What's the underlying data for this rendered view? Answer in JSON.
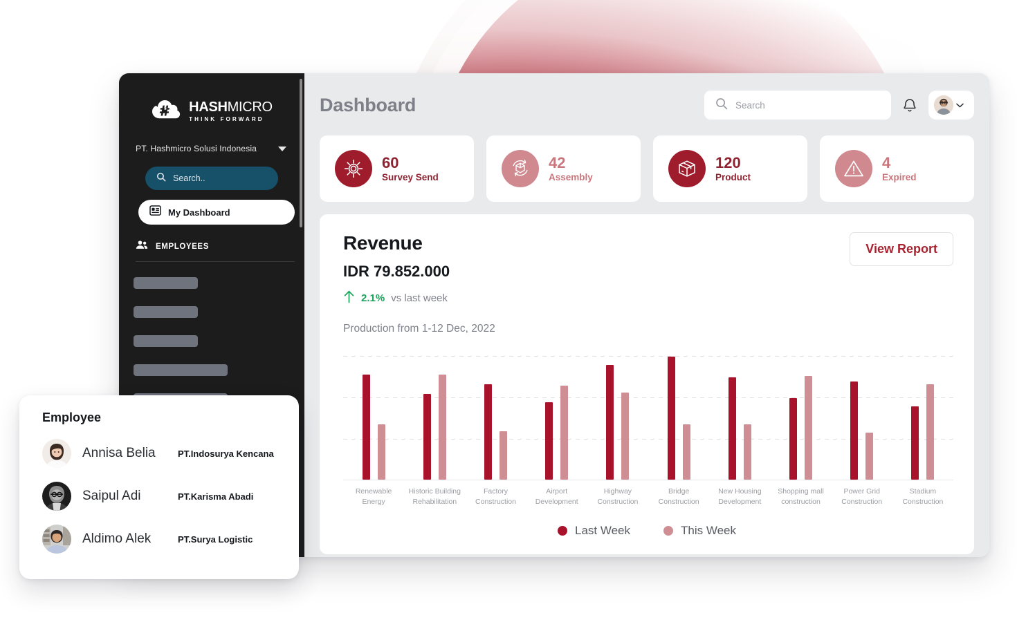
{
  "brand": {
    "name_bold": "HASH",
    "name_light": "MICRO",
    "tagline": "THINK FORWARD",
    "logo_icon": "hash-cloud-logo-icon"
  },
  "sidebar": {
    "company": "PT. Hashmicro Solusi Indonesia",
    "company_caret_icon": "chevron-down-icon",
    "search_placeholder": "Search..",
    "search_icon": "search-icon",
    "active_item": {
      "label": "My Dashboard",
      "icon": "dashboard-icon"
    },
    "section": {
      "label": "EMPLOYEES",
      "icon": "people-icon"
    },
    "skeleton_widths": [
      93,
      93,
      93,
      136,
      136
    ]
  },
  "header": {
    "title": "Dashboard",
    "search_placeholder": "Search",
    "search_value": "",
    "search_icon": "search-icon",
    "bell_icon": "bell-icon",
    "avatar_icon": "user-avatar",
    "profile_caret_icon": "chevron-down-icon"
  },
  "stats": [
    {
      "value": "60",
      "label": "Survey Send",
      "icon": "gear-icon",
      "tone": "dark"
    },
    {
      "value": "42",
      "label": "Assembly",
      "icon": "assembly-icon",
      "tone": "light"
    },
    {
      "value": "120",
      "label": "Product",
      "icon": "box-icon",
      "tone": "dark"
    },
    {
      "value": "4",
      "label": "Expired",
      "icon": "warning-icon",
      "tone": "light"
    }
  ],
  "revenue": {
    "title": "Revenue",
    "amount": "IDR 79.852.000",
    "delta_arrow_icon": "arrow-up-icon",
    "delta_pct": "2.1%",
    "delta_note": "vs last week",
    "subtitle": "Production from 1-12 Dec, 2022",
    "view_report_label": "View Report"
  },
  "chart_data": {
    "type": "bar",
    "title": "Production from 1-12 Dec, 2022",
    "xlabel": "",
    "ylabel": "",
    "ylim": [
      0,
      100
    ],
    "grid": true,
    "gridlines": [
      30,
      60,
      90
    ],
    "legend_position": "bottom",
    "categories": [
      "Renewable Energy",
      "Historic Building Rehabilitation",
      "Factory Construction",
      "Airport Development",
      "Highway Construction",
      "Bridge Construction",
      "New Housing Development",
      "Shopping mall construction",
      "Power Grid Construction",
      "Stadium Construction"
    ],
    "category_lines": [
      [
        "Renewable",
        "Energy"
      ],
      [
        "Historic Building",
        "Rehabilitation"
      ],
      [
        "Factory",
        "Construction"
      ],
      [
        "Airport",
        "Development"
      ],
      [
        "Highway",
        "Construction"
      ],
      [
        "Bridge",
        "Construction"
      ],
      [
        "New Housing",
        "Development"
      ],
      [
        "Shopping mall",
        "construction"
      ],
      [
        "Power Grid",
        "Construction"
      ],
      [
        "Stadium",
        "Construction"
      ]
    ],
    "series": [
      {
        "name": "Last Week",
        "color": "#a8122a",
        "values": [
          76,
          62,
          69,
          56,
          83,
          89,
          74,
          59,
          71,
          53
        ]
      },
      {
        "name": "This Week",
        "color": "#cf8e93",
        "values": [
          40,
          76,
          35,
          68,
          63,
          40,
          40,
          75,
          34,
          69
        ]
      }
    ]
  },
  "chart_legend": [
    {
      "label": "Last Week",
      "color": "#a8122a"
    },
    {
      "label": "This Week",
      "color": "#cf8e93"
    }
  ],
  "employee_card": {
    "title": "Employee",
    "rows": [
      {
        "name": "Annisa Belia",
        "org": "PT.Indosurya Kencana",
        "avatar": "avatar-annisa"
      },
      {
        "name": "Saipul Adi",
        "org": "PT.Karisma Abadi",
        "avatar": "avatar-saipul"
      },
      {
        "name": "Aldimo Alek",
        "org": "PT.Surya Logistic",
        "avatar": "avatar-aldimo"
      }
    ]
  },
  "colors": {
    "brand_dark_red": "#9f1c2c",
    "brand_light_red": "#d08a8f",
    "sidebar_bg": "#1c1c1c",
    "sidebar_search_bg": "#175069",
    "app_bg": "#e9eaec",
    "positive_green": "#1aa35b",
    "accent_circle": "#b22f3c"
  }
}
